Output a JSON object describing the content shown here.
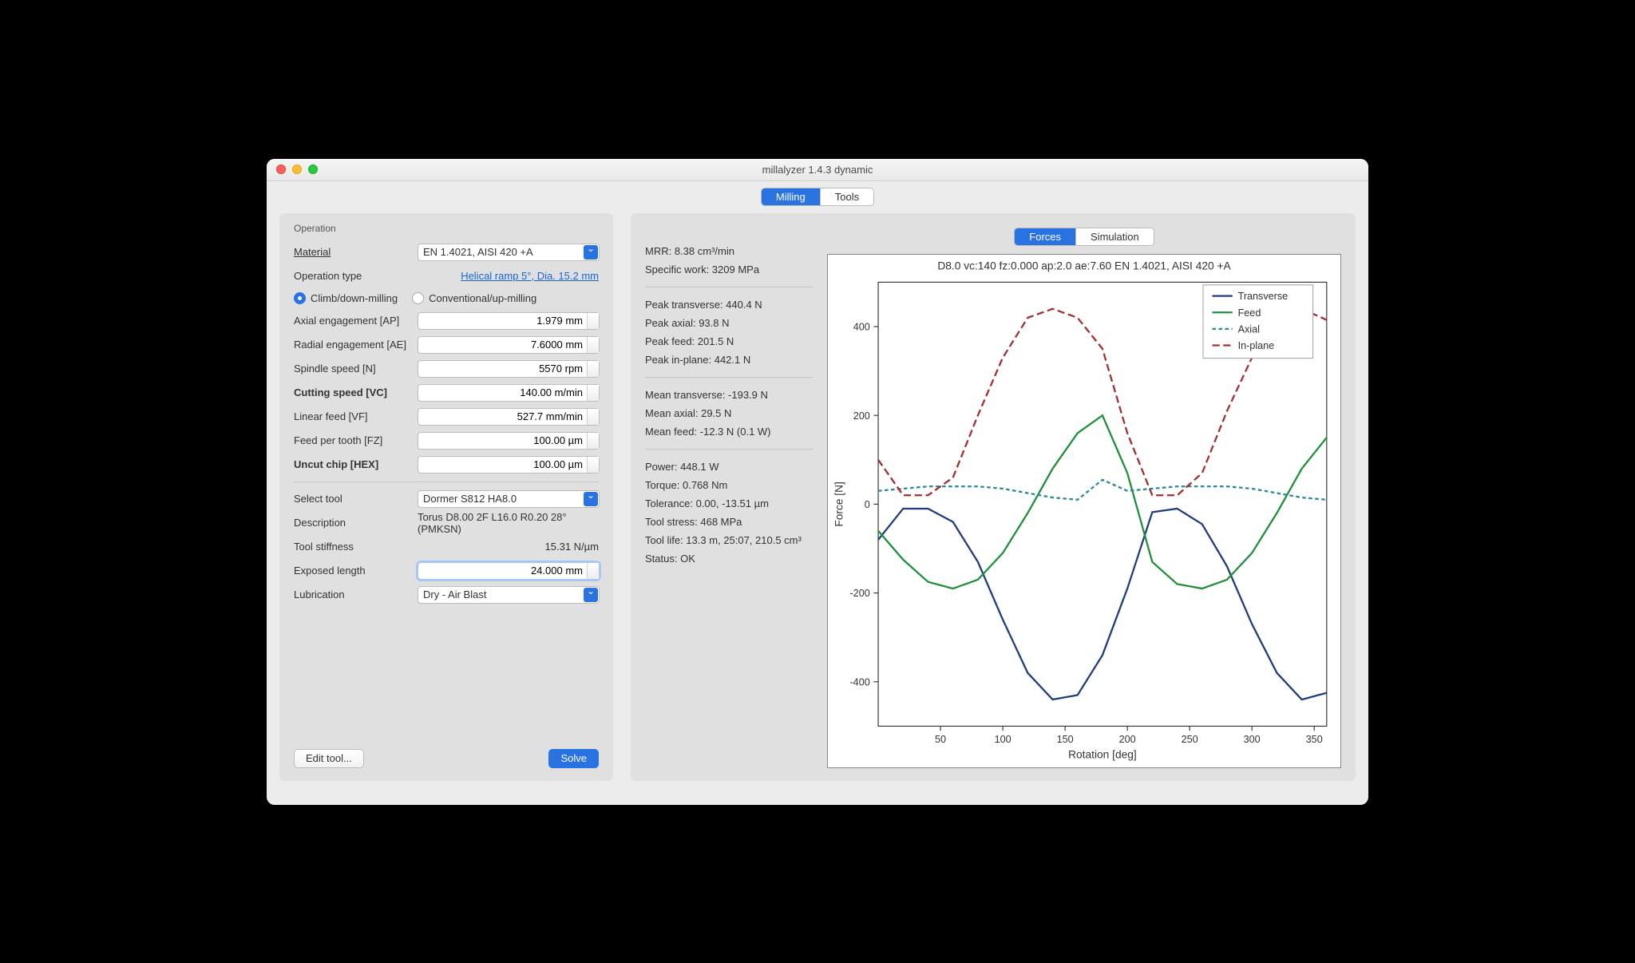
{
  "window": {
    "title": "millalyzer 1.4.3 dynamic"
  },
  "top_tabs": {
    "items": [
      "Milling",
      "Tools"
    ],
    "active": 0
  },
  "right_tabs": {
    "items": [
      "Forces",
      "Simulation"
    ],
    "active": 0
  },
  "operation": {
    "section_label": "Operation",
    "material_label": "Material",
    "material_value": "EN 1.4021, AISI 420 +A",
    "op_type_label": "Operation type",
    "op_type_link": "Helical ramp 5°, Dia. 15.2 mm",
    "radio_climb": "Climb/down-milling",
    "radio_conv": "Conventional/up-milling",
    "fields": [
      {
        "label": "Axial engagement [AP]",
        "value": "1.979 mm",
        "bold": false
      },
      {
        "label": "Radial engagement [AE]",
        "value": "7.6000 mm",
        "bold": false
      },
      {
        "label": "Spindle speed [N]",
        "value": "5570 rpm",
        "bold": false
      },
      {
        "label": "Cutting speed [VC]",
        "value": "140.00 m/min",
        "bold": true
      },
      {
        "label": "Linear feed [VF]",
        "value": "527.7 mm/min",
        "bold": false
      },
      {
        "label": "Feed per tooth [FZ]",
        "value": "100.00 µm",
        "bold": false
      },
      {
        "label": "Uncut chip [HEX]",
        "value": "100.00 µm",
        "bold": true
      }
    ],
    "tool_label": "Select tool",
    "tool_value": "Dormer S812 HA8.0",
    "desc_label": "Description",
    "desc_value": "Torus D8.00 2F L16.0 R0.20 28° (PMKSN)",
    "stiff_label": "Tool stiffness",
    "stiff_value": "15.31 N/µm",
    "exposed_label": "Exposed length",
    "exposed_value": "24.000 mm",
    "lube_label": "Lubrication",
    "lube_value": "Dry - Air Blast",
    "edit_btn": "Edit tool...",
    "solve_btn": "Solve"
  },
  "results": {
    "mrr": "MRR: 8.38 cm³/min",
    "spec": "Specific work: 3209 MPa",
    "peak_t": "Peak transverse: 440.4 N",
    "peak_a": "Peak axial: 93.8 N",
    "peak_f": "Peak feed: 201.5 N",
    "peak_i": "Peak in-plane: 442.1 N",
    "mean_t": "Mean transverse: -193.9 N",
    "mean_a": "Mean axial: 29.5 N",
    "mean_f": "Mean feed: -12.3 N (0.1 W)",
    "power": "Power: 448.1 W",
    "torque": "Torque: 0.768 Nm",
    "tol": "Tolerance: 0.00, -13.51 µm",
    "stress": "Tool stress: 468 MPa",
    "life": "Tool life: 13.3 m, 25:07, 210.5 cm³",
    "status": "Status: OK"
  },
  "chart_data": {
    "type": "line",
    "title": "D8.0 vc:140 fz:0.000 ap:2.0 ae:7.60 EN 1.4021, AISI 420 +A",
    "xlabel": "Rotation [deg]",
    "ylabel": "Force [N]",
    "xlim": [
      0,
      360
    ],
    "ylim": [
      -500,
      500
    ],
    "xticks": [
      50,
      100,
      150,
      200,
      250,
      300,
      350
    ],
    "yticks": [
      -400,
      -200,
      0,
      200,
      400
    ],
    "legend": [
      "Transverse",
      "Feed",
      "Axial",
      "In-plane"
    ],
    "series": [
      {
        "name": "Transverse",
        "color": "#1f3d7a",
        "dash": "none",
        "x": [
          0,
          20,
          40,
          60,
          80,
          100,
          120,
          140,
          160,
          180,
          200,
          220,
          240,
          260,
          280,
          300,
          320,
          340,
          360
        ],
        "y": [
          -80,
          -10,
          -10,
          -40,
          -130,
          -260,
          -380,
          -440,
          -430,
          -340,
          -190,
          -18,
          -10,
          -45,
          -140,
          -270,
          -380,
          -440,
          -425
        ]
      },
      {
        "name": "Feed",
        "color": "#1f8f3a",
        "dash": "none",
        "x": [
          0,
          20,
          40,
          60,
          80,
          100,
          120,
          140,
          160,
          180,
          200,
          220,
          240,
          260,
          280,
          300,
          320,
          340,
          360
        ],
        "y": [
          -60,
          -125,
          -175,
          -190,
          -170,
          -110,
          -20,
          80,
          160,
          200,
          70,
          -130,
          -180,
          -190,
          -170,
          -110,
          -20,
          80,
          150
        ]
      },
      {
        "name": "Axial",
        "color": "#2d8a92",
        "dash": "4 3",
        "x": [
          0,
          20,
          40,
          60,
          80,
          100,
          120,
          140,
          160,
          180,
          200,
          220,
          240,
          260,
          280,
          300,
          320,
          340,
          360
        ],
        "y": [
          30,
          35,
          40,
          40,
          40,
          35,
          25,
          15,
          10,
          55,
          30,
          35,
          40,
          40,
          40,
          35,
          25,
          15,
          10
        ]
      },
      {
        "name": "In-plane",
        "color": "#a03030",
        "dash": "8 4",
        "x": [
          0,
          20,
          40,
          60,
          80,
          100,
          120,
          140,
          160,
          180,
          200,
          220,
          240,
          260,
          280,
          300,
          320,
          340,
          360
        ],
        "y": [
          100,
          20,
          20,
          60,
          200,
          330,
          420,
          440,
          420,
          350,
          160,
          20,
          20,
          70,
          210,
          330,
          420,
          440,
          415
        ]
      }
    ]
  }
}
